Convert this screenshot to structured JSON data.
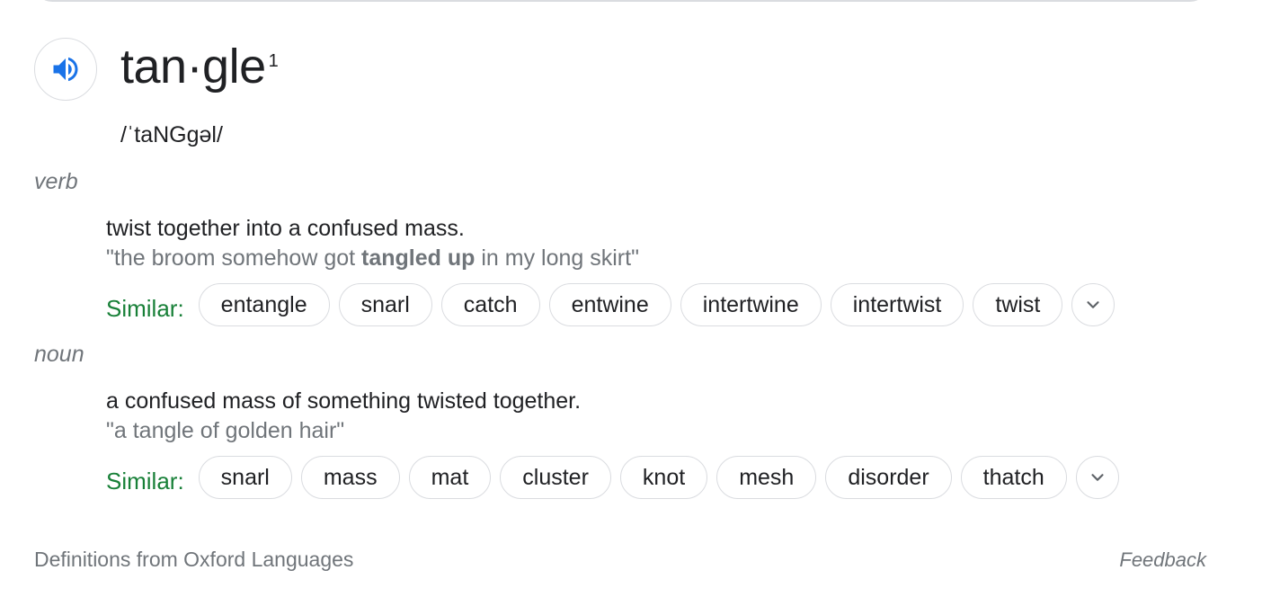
{
  "entry": {
    "word": "tan·gle",
    "homograph_number": "1",
    "pronunciation": "/ˈtaNGɡəl/",
    "audio_icon": "speaker-icon",
    "accent_color": "#1a73e8"
  },
  "senses": [
    {
      "part_of_speech": "verb",
      "definition": "twist together into a confused mass.",
      "example_prefix": "\"the broom somehow got ",
      "example_bold": "tangled up",
      "example_suffix": " in my long skirt\"",
      "similar_label": "Similar:",
      "similar": [
        "entangle",
        "snarl",
        "catch",
        "entwine",
        "intertwine",
        "intertwist",
        "twist"
      ]
    },
    {
      "part_of_speech": "noun",
      "definition": "a confused mass of something twisted together.",
      "example_text": "\"a tangle of golden hair\"",
      "similar_label": "Similar:",
      "similar": [
        "snarl",
        "mass",
        "mat",
        "cluster",
        "knot",
        "mesh",
        "disorder",
        "thatch"
      ]
    }
  ],
  "footer": {
    "attribution": "Definitions from Oxford Languages",
    "feedback": "Feedback"
  },
  "colors": {
    "similar_label": "#188038",
    "muted_text": "#70757a",
    "chip_border": "#dadce0"
  }
}
